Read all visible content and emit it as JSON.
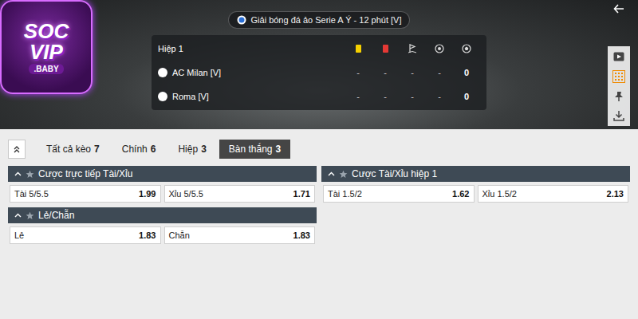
{
  "logo": {
    "line1": "SOC",
    "line2": "VIP",
    "badge": ".BABY"
  },
  "match_title": "Giải bóng đá ảo Serie A Ý - 12 phút [V]",
  "scoreboard": {
    "period": "Hiệp 1",
    "teams": [
      {
        "name": "AC Milan [V]",
        "stats": [
          "-",
          "-",
          "-",
          "-",
          "0"
        ]
      },
      {
        "name": "Roma [V]",
        "stats": [
          "-",
          "-",
          "-",
          "-",
          "0"
        ]
      }
    ]
  },
  "tabs": [
    {
      "label": "Tất cả kèo",
      "count": "7",
      "selected": false
    },
    {
      "label": "Chính",
      "count": "6",
      "selected": false
    },
    {
      "label": "Hiệp",
      "count": "3",
      "selected": false
    },
    {
      "label": "Bàn thắng",
      "count": "3",
      "selected": true
    }
  ],
  "columns": [
    [
      {
        "title": "Cược trực tiếp Tài/Xỉu",
        "expanded": true,
        "favorite": false,
        "odds": [
          {
            "label": "Tài 5/5.5",
            "price": "1.99"
          },
          {
            "label": "Xỉu 5/5.5",
            "price": "1.71"
          }
        ]
      },
      {
        "title": "Lẻ/Chẵn",
        "expanded": true,
        "favorite": false,
        "odds": [
          {
            "label": "Lẻ",
            "price": "1.83"
          },
          {
            "label": "Chẵn",
            "price": "1.83"
          }
        ]
      }
    ],
    [
      {
        "title": "Cược Tài/Xỉu hiệp 1",
        "expanded": true,
        "favorite": false,
        "odds": [
          {
            "label": "Tài 1.5/2",
            "price": "1.62"
          },
          {
            "label": "Xỉu 1.5/2",
            "price": "2.13"
          }
        ]
      }
    ]
  ]
}
